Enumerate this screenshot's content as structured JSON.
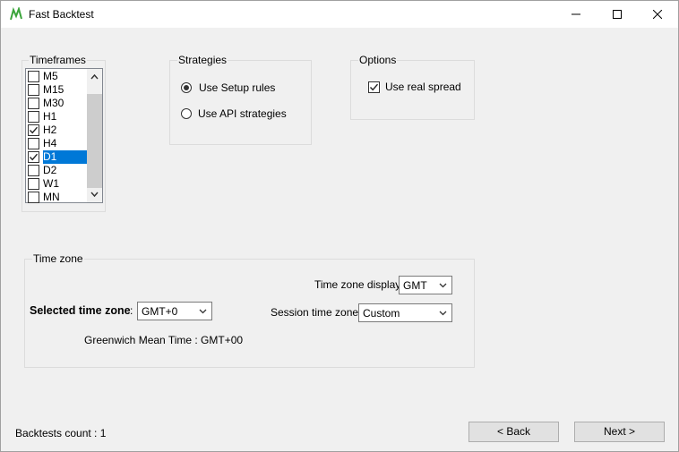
{
  "window": {
    "title": "Fast Backtest"
  },
  "timeframes": {
    "label": "Timeframes",
    "items": [
      {
        "label": "M5",
        "checked": false,
        "selected": false
      },
      {
        "label": "M15",
        "checked": false,
        "selected": false
      },
      {
        "label": "M30",
        "checked": false,
        "selected": false
      },
      {
        "label": "H1",
        "checked": false,
        "selected": false
      },
      {
        "label": "H2",
        "checked": true,
        "selected": false
      },
      {
        "label": "H4",
        "checked": false,
        "selected": false
      },
      {
        "label": "D1",
        "checked": true,
        "selected": true
      },
      {
        "label": "D2",
        "checked": false,
        "selected": false
      },
      {
        "label": "W1",
        "checked": false,
        "selected": false
      },
      {
        "label": "MN",
        "checked": false,
        "selected": false
      }
    ]
  },
  "strategies": {
    "label": "Strategies",
    "option_setup": "Use Setup rules",
    "option_api": "Use API strategies",
    "selected": "setup"
  },
  "options": {
    "label": "Options",
    "real_spread": "Use real spread",
    "real_spread_checked": true
  },
  "timezone": {
    "label": "Time zone",
    "display_label": "Time zone display :",
    "display_value": "GMT",
    "selected_label": "Selected time zone",
    "selected_colon": ":",
    "selected_value": "GMT+0",
    "session_label": "Session time zones :",
    "session_value": "Custom",
    "description": "Greenwich Mean Time : GMT+00"
  },
  "footer": {
    "count_text": "Backtests count : 1",
    "back_label": "< Back",
    "next_label": "Next >"
  }
}
